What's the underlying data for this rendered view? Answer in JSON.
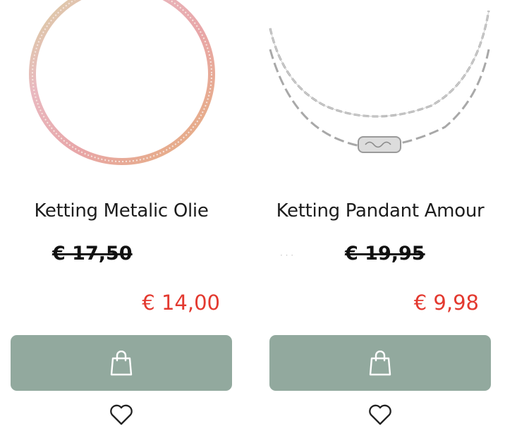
{
  "products": [
    {
      "title": "Ketting Metalic Olie",
      "old_price": "€ 17,50",
      "new_price": "€ 14,00",
      "image_icon": "necklace-omega-collar-image",
      "cart_icon": "shopping-bag-icon",
      "wishlist_icon": "heart-outline-icon"
    },
    {
      "title": "Ketting Pandant Amour",
      "old_price": "€ 19,95",
      "new_price": "€ 9,98",
      "image_icon": "necklace-layered-chain-image",
      "cart_icon": "shopping-bag-icon",
      "wishlist_icon": "heart-outline-icon"
    }
  ],
  "colors": {
    "button_bg": "#92a99e",
    "sale_price": "#e3392f",
    "text": "#1c1c1c"
  }
}
